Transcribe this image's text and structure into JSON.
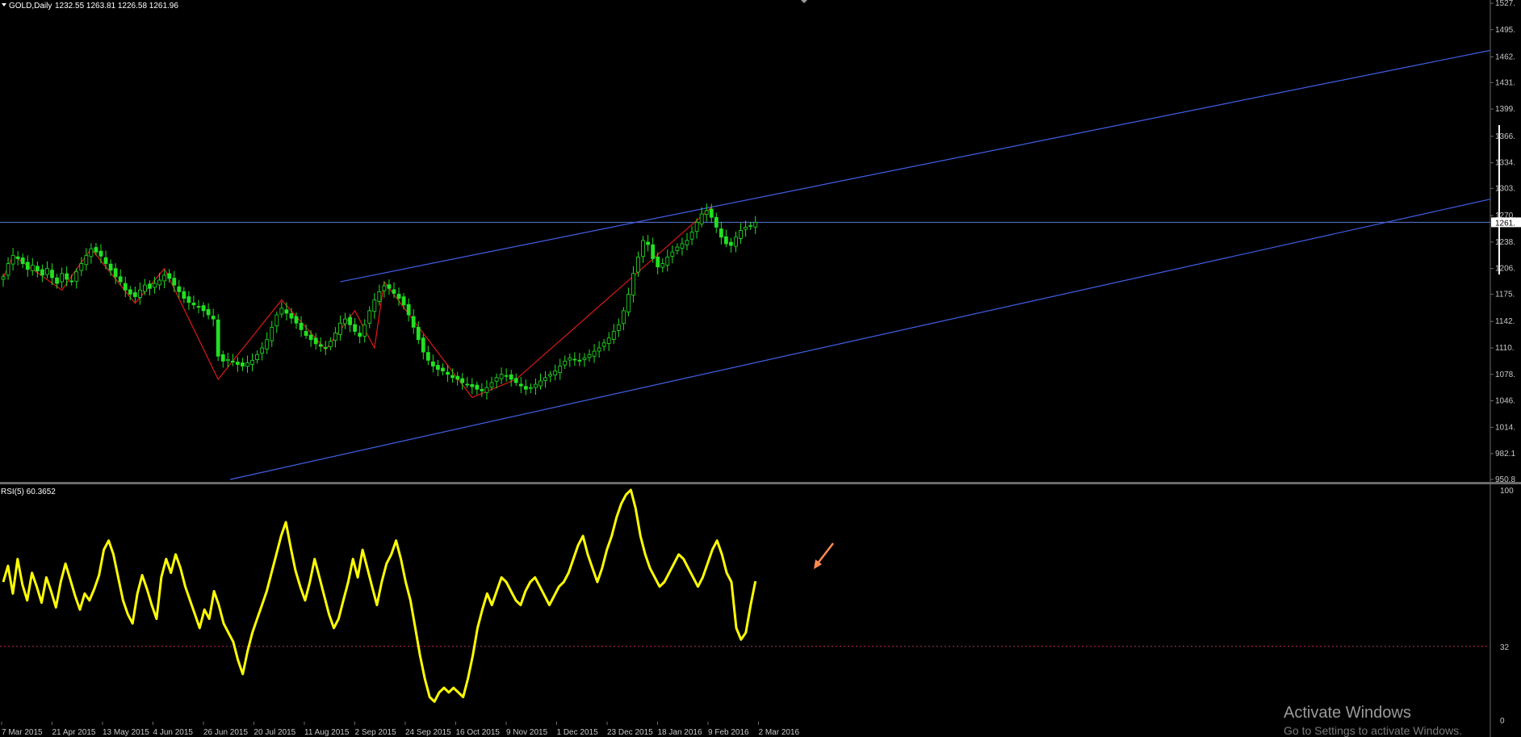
{
  "header": {
    "symbol": "GOLD,Daily",
    "ohlc": "1232.55 1263.81 1226.58 1261.96"
  },
  "rsi_header": "RSI(5) 60.3652",
  "watermark": {
    "line1": "Activate Windows",
    "line2": "Go to Settings to activate Windows."
  },
  "colors": {
    "background": "#000000",
    "bull_candle": "#22e022",
    "zigzag": "#e01818",
    "trendline": "#3f5fe6",
    "price_line": "#5a7ad8",
    "rsi_line": "#ffff00",
    "rsi_level": "#b03050",
    "axis_text": "#c8c8c8",
    "annotation_arrow": "#ff8a50"
  },
  "chart_data": [
    {
      "type": "candlestick",
      "title": "GOLD,Daily",
      "ohlc_last": {
        "open": 1232.55,
        "high": 1263.81,
        "low": 1226.58,
        "close": 1261.96
      },
      "y_ticks": [
        "950.8",
        "982.1",
        "1014.",
        "1046.",
        "1078.",
        "1110.",
        "1142.",
        "1175.",
        "1206.",
        "1238.",
        "1270.",
        "1303.",
        "1334.",
        "1366.",
        "1399.",
        "1431.",
        "1462.",
        "1495.",
        "1527."
      ],
      "ylim": [
        950.8,
        1527
      ],
      "current_price": 1261.96,
      "current_price_label": "1261.",
      "x_ticks": [
        "7 Mar 2015",
        "21 Apr 2015",
        "13 May 2015",
        "4 Jun 2015",
        "26 Jun 2015",
        "20 Jul 2015",
        "11 Aug 2015",
        "2 Sep 2015",
        "24 Sep 2015",
        "16 Oct 2015",
        "9 Nov 2015",
        "1 Dec 2015",
        "23 Dec 2015",
        "18 Jan 2016",
        "9 Feb 2016",
        "2 Mar 2016"
      ],
      "close_path": [
        1196,
        1212,
        1222,
        1218,
        1212,
        1205,
        1210,
        1203,
        1198,
        1206,
        1195,
        1188,
        1200,
        1193,
        1190,
        1202,
        1212,
        1222,
        1230,
        1226,
        1221,
        1212,
        1204,
        1196,
        1190,
        1180,
        1175,
        1172,
        1180,
        1186,
        1182,
        1188,
        1192,
        1198,
        1194,
        1186,
        1178,
        1170,
        1165,
        1162,
        1160,
        1155,
        1150,
        1145,
        1100,
        1094,
        1096,
        1093,
        1090,
        1088,
        1092,
        1095,
        1102,
        1110,
        1120,
        1135,
        1150,
        1158,
        1152,
        1146,
        1140,
        1132,
        1125,
        1120,
        1115,
        1112,
        1110,
        1118,
        1128,
        1140,
        1145,
        1138,
        1130,
        1124,
        1138,
        1155,
        1168,
        1178,
        1185,
        1182,
        1176,
        1170,
        1162,
        1150,
        1135,
        1120,
        1105,
        1095,
        1088,
        1084,
        1082,
        1078,
        1074,
        1072,
        1068,
        1066,
        1063,
        1060,
        1058,
        1062,
        1068,
        1074,
        1078,
        1076,
        1072,
        1068,
        1064,
        1060,
        1062,
        1066,
        1070,
        1074,
        1078,
        1082,
        1088,
        1094,
        1098,
        1096,
        1094,
        1098,
        1102,
        1106,
        1110,
        1116,
        1122,
        1130,
        1138,
        1155,
        1175,
        1200,
        1220,
        1240,
        1235,
        1218,
        1208,
        1212,
        1220,
        1226,
        1232,
        1236,
        1240,
        1250,
        1262,
        1272,
        1276,
        1268,
        1256,
        1244,
        1236,
        1234,
        1244,
        1252,
        1256,
        1258,
        1261.96
      ],
      "zigzag_points": [
        [
          "7 Mar 2015",
          1195
        ],
        [
          "early Mar 2015",
          1222
        ],
        [
          "late Apr 2015",
          1180
        ],
        [
          "13 May 2015",
          1230
        ],
        [
          "4 Jun 2015",
          1164
        ],
        [
          "mid Jun 2015",
          1206
        ],
        [
          "20 Jul 2015",
          1072
        ],
        [
          "11 Aug 2015",
          1168
        ],
        [
          "2 Sep 2015",
          1108
        ],
        [
          "24 Sep 2015",
          1155
        ],
        [
          "late Sep 2015",
          1110
        ],
        [
          "16 Oct 2015",
          1190
        ],
        [
          "1 Dec 2015",
          1050
        ],
        [
          "23 Dec 2015",
          1072
        ],
        [
          "2 Mar 2016",
          1280
        ]
      ],
      "channel_upper": [
        [
          "16 Oct 2015",
          1190
        ],
        [
          "right edge",
          1470
        ]
      ],
      "channel_lower": [
        [
          "left edge",
          950.8
        ],
        [
          "right edge",
          1290
        ]
      ]
    },
    {
      "type": "line",
      "title": "RSI(5) 60.3652",
      "series": [
        {
          "name": "RSI(5)",
          "values": [
            60,
            67,
            55,
            70,
            59,
            52,
            64,
            58,
            51,
            62,
            56,
            49,
            60,
            68,
            61,
            54,
            48,
            55,
            52,
            57,
            63,
            74,
            78,
            72,
            62,
            52,
            46,
            42,
            55,
            63,
            57,
            50,
            44,
            62,
            70,
            64,
            72,
            66,
            58,
            52,
            46,
            40,
            48,
            44,
            56,
            50,
            42,
            38,
            34,
            26,
            20,
            30,
            38,
            44,
            50,
            56,
            64,
            72,
            80,
            86,
            75,
            65,
            58,
            52,
            60,
            70,
            62,
            54,
            46,
            40,
            44,
            52,
            60,
            70,
            62,
            74,
            66,
            58,
            50,
            60,
            68,
            72,
            78,
            70,
            60,
            52,
            40,
            28,
            18,
            10,
            8,
            12,
            14,
            12,
            14,
            12,
            10,
            18,
            28,
            40,
            48,
            55,
            50,
            56,
            62,
            60,
            56,
            52,
            50,
            56,
            60,
            62,
            58,
            54,
            50,
            54,
            58,
            60,
            64,
            70,
            76,
            80,
            72,
            66,
            60,
            66,
            74,
            80,
            88,
            94,
            98,
            100,
            92,
            80,
            72,
            66,
            62,
            58,
            60,
            64,
            68,
            72,
            70,
            66,
            62,
            58,
            62,
            68,
            74,
            78,
            72,
            64,
            60,
            40,
            35,
            38,
            50,
            60.3652
          ]
        }
      ],
      "ylim": [
        0,
        100
      ],
      "y_ticks": [
        "100",
        "32",
        "0"
      ],
      "level": 32
    }
  ]
}
